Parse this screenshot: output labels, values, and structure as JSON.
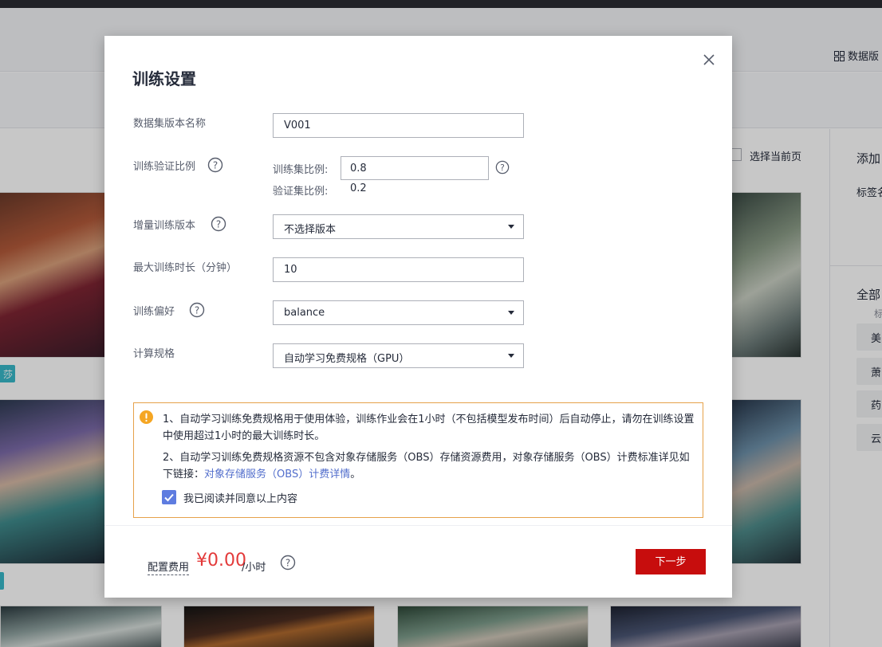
{
  "background": {
    "dataset_link": "数据版",
    "select_page_label": "选择当前页",
    "right_panel": {
      "add": "添加",
      "tag_name": "标签名",
      "all": "全部",
      "sub": "标",
      "chips": [
        "美",
        "萧",
        "药",
        "云"
      ]
    },
    "thumb_tags": [
      "莎",
      ""
    ]
  },
  "dialog": {
    "title": "训练设置",
    "close_icon": "close-icon",
    "fields": {
      "dataset_version_label": "数据集版本名称",
      "dataset_version_value": "V001",
      "split_label": "训练验证比例",
      "train_ratio_label": "训练集比例:",
      "train_ratio_value": "0.8",
      "val_ratio_label": "验证集比例:",
      "val_ratio_value": "0.2",
      "incremental_label": "增量训练版本",
      "incremental_value": "不选择版本",
      "max_time_label": "最大训练时长（分钟）",
      "max_time_value": "10",
      "preference_label": "训练偏好",
      "preference_value": "balance",
      "spec_label": "计算规格",
      "spec_value": "自动学习免费规格（GPU）"
    },
    "notice": {
      "line1": "1、自动学习训练免费规格用于使用体验，训练作业会在1小时（不包括模型发布时间）后自动停止，请勿在训练设置中使用超过1小时的最大训练时长。",
      "line2_prefix": "2、自动学习训练免费规格资源不包含对象存储服务（OBS）存储资源费用，对象存储服务（OBS）计费标准详见如下链接：",
      "line2_link": "对象存储服务（OBS）计费详情",
      "line2_suffix": "。",
      "agree_label": "我已阅读并同意以上内容",
      "agree_checked": true
    },
    "footer": {
      "fee_label": "配置费用",
      "fee_amount": "¥0.00",
      "fee_unit": "/小时",
      "next_button": "下一步"
    }
  },
  "colors": {
    "primary_red": "#c70d0d",
    "price_red": "#e33a3a",
    "checkbox_blue": "#5e7ce0",
    "link_blue": "#526ecc",
    "warning_orange": "#f5a623",
    "notice_border": "#e6a24a"
  }
}
